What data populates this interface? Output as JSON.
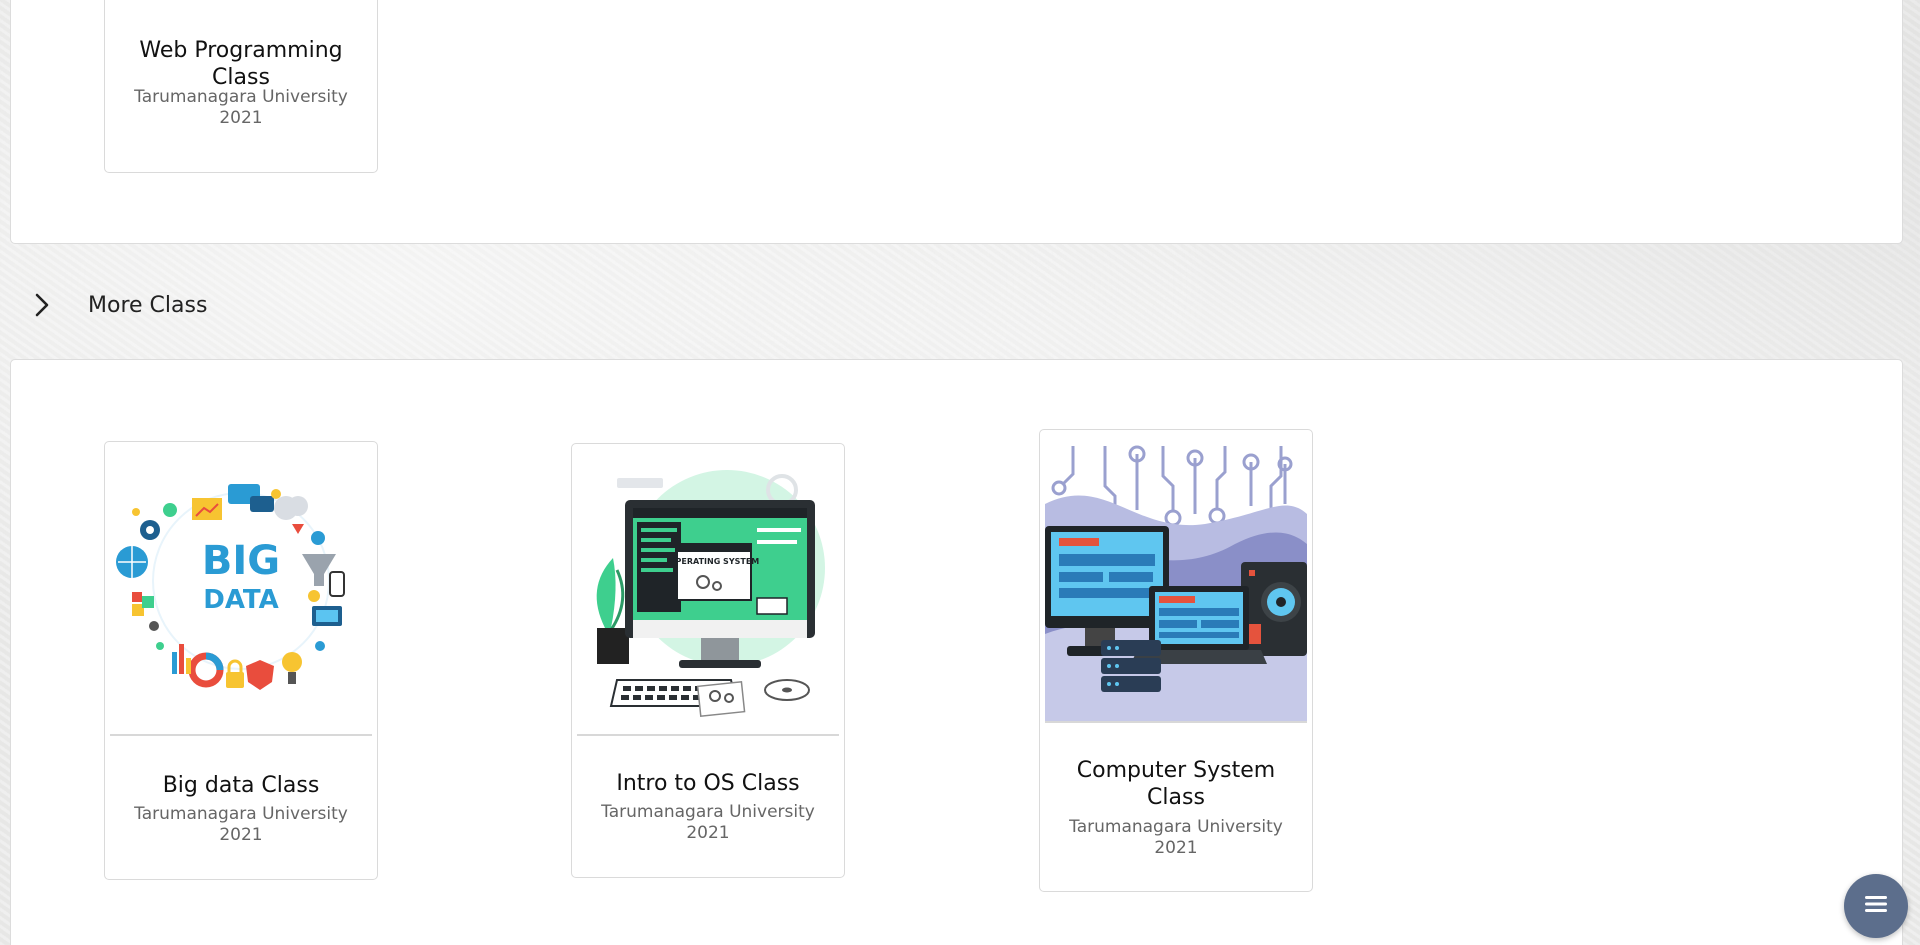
{
  "top_section": {
    "cards": [
      {
        "title": "Web Programming Class",
        "institution": "Tarumanagara University",
        "year": "2021"
      }
    ]
  },
  "more_section": {
    "title": "More Class",
    "toggle_icon": "chevron-right-icon",
    "cards": [
      {
        "title": "Big data Class",
        "institution": "Tarumanagara University",
        "year": "2021",
        "image_text": [
          "BIG",
          "DATA"
        ]
      },
      {
        "title": "Intro to OS Class",
        "institution": "Tarumanagara University",
        "year": "2021",
        "image_text": "OPERATING SYSTEM"
      },
      {
        "title": "Computer System Class",
        "institution": "Tarumanagara University",
        "year": "2021"
      }
    ]
  },
  "fab": {
    "icon": "menu-icon",
    "color": "#5c6e8c"
  },
  "colors": {
    "panel_background": "#ffffff",
    "page_background": "#ececeb",
    "big_data_accent": "#2a9bd4",
    "os_accent": "#3ecf8e",
    "computer_system_accent": "#8a8fc8"
  }
}
